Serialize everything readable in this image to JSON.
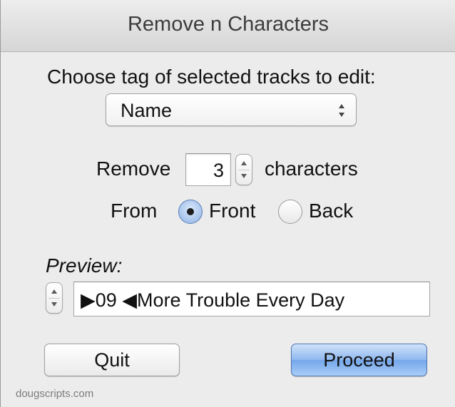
{
  "window": {
    "title": "Remove n Characters"
  },
  "tag_section": {
    "prompt": "Choose tag of selected tracks to edit:",
    "selected_tag": "Name"
  },
  "remove_section": {
    "remove_label": "Remove",
    "count_value": "3",
    "characters_label": "characters"
  },
  "from_section": {
    "from_label": "From",
    "options": [
      {
        "label": "Front",
        "selected": true
      },
      {
        "label": "Back",
        "selected": false
      }
    ]
  },
  "preview_section": {
    "label": "Preview:",
    "text": "▶09 ◀More Trouble Every Day"
  },
  "buttons": {
    "quit": "Quit",
    "proceed": "Proceed"
  },
  "footer": {
    "credit": "dougscripts.com"
  },
  "colors": {
    "accent": "#74a6ea",
    "window_bg": "#ececec"
  },
  "icons": {
    "popup": "up-down-arrows-icon",
    "stepper": "stepper-arrows-icon"
  }
}
